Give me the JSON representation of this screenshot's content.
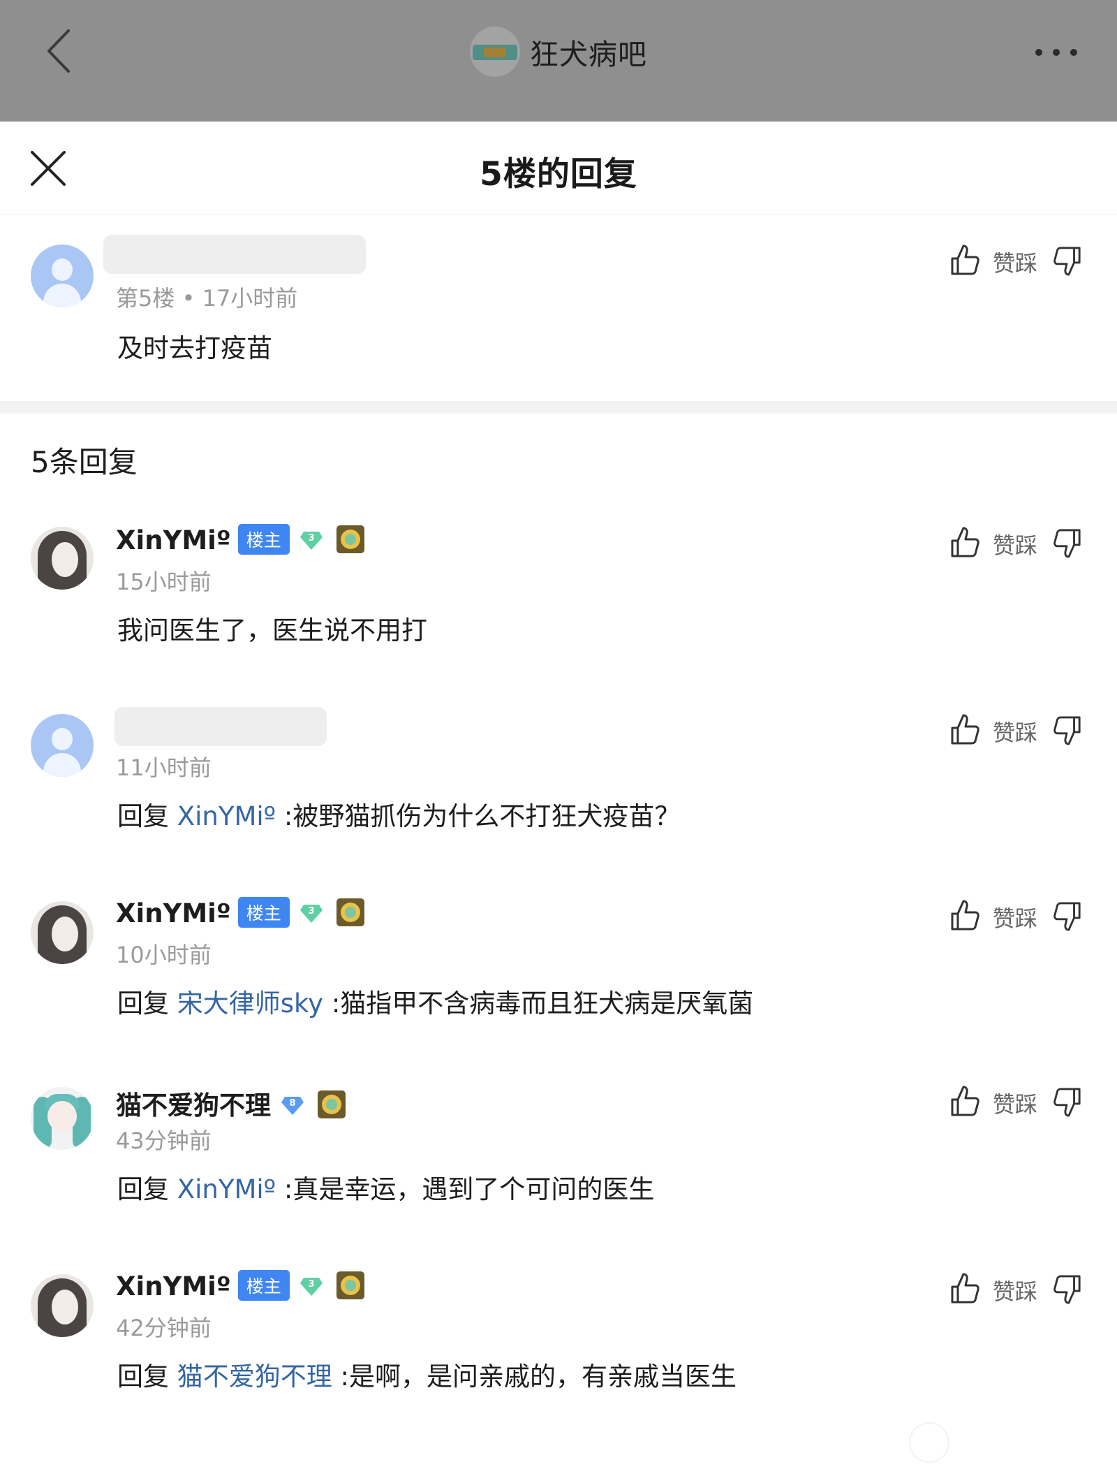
{
  "topbar": {
    "forum_name": "狂犬病吧",
    "icons": [
      "back-arrow-icon",
      "forum-logo",
      "more-dots-icon"
    ]
  },
  "sheet": {
    "title": "5楼的回复"
  },
  "floor_post": {
    "meta": "第5楼 • 17小时前",
    "content": "及时去打疫苗",
    "vote_label": "赞踩"
  },
  "replies_header": "5条回复",
  "replies": [
    {
      "username": "XinYMiº",
      "badge": "楼主",
      "level": "3",
      "time": "15小时前",
      "content": "我问医生了，医生说不用打",
      "vote_label": "赞踩"
    },
    {
      "username": "",
      "time": "11小时前",
      "reply_prefix": "回复",
      "mention": "XinYMiº",
      "content": ":被野猫抓伤为什么不打狂犬疫苗？",
      "vote_label": "赞踩"
    },
    {
      "username": "XinYMiº",
      "badge": "楼主",
      "level": "3",
      "time": "10小时前",
      "reply_prefix": "回复",
      "mention": "宋大律师sky",
      "content": ":猫指甲不含病毒而且狂犬病是厌氧菌",
      "vote_label": "赞踩"
    },
    {
      "username": "猫不爱狗不理",
      "level": "8",
      "time": "43分钟前",
      "reply_prefix": "回复",
      "mention": "XinYMiº",
      "content": ":真是幸运，遇到了个可问的医生",
      "vote_label": "赞踩"
    },
    {
      "username": "XinYMiº",
      "badge": "楼主",
      "level": "3",
      "time": "42分钟前",
      "reply_prefix": "回复",
      "mention": "猫不爱狗不理",
      "content": ":是啊，是问亲戚的，有亲戚当医生",
      "vote_label": "赞踩"
    }
  ],
  "colors": {
    "topbar_bg": "#8f8f90",
    "badge_blue": "#3f86f2",
    "mention_blue": "#3466a4",
    "gem_green": "#5fd0a4",
    "gem_blue": "#5b9bf2",
    "meta_gray": "#9a9a9a"
  }
}
